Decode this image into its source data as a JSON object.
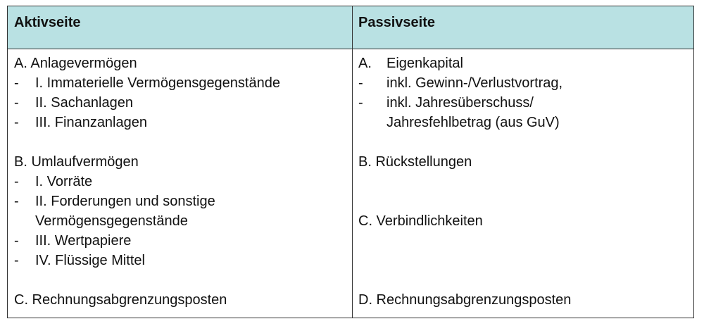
{
  "header": {
    "left": "Aktivseite",
    "right": "Passivseite"
  },
  "aktiv": {
    "a_title": "A. Anlagevermögen",
    "a_items": [
      "I. Immaterielle Vermögensgegenstände",
      "II. Sachanlagen",
      "III. Finanzanlagen"
    ],
    "b_title": "B. Umlaufvermögen",
    "b_item1": "I. Vorräte",
    "b_item2_line1": "II. Forderungen und sonstige",
    "b_item2_line2": "Vermögensgegenstände",
    "b_item3": "III. Wertpapiere",
    "b_item4": "IV. Flüssige Mittel",
    "c_title": "C. Rechnungsabgrenzungsposten"
  },
  "passiv": {
    "a_letter": "A.",
    "a_title": "Eigenkapital",
    "a_item1": "inkl. Gewinn-/Verlustvortrag,",
    "a_item2_line1": "inkl. Jahresüberschuss/",
    "a_item2_line2": "Jahresfehlbetrag (aus GuV)",
    "b_title": "B. Rückstellungen",
    "c_title": "C. Verbindlichkeiten",
    "d_title": "D. Rechnungsabgrenzungsposten"
  },
  "dash": "-"
}
